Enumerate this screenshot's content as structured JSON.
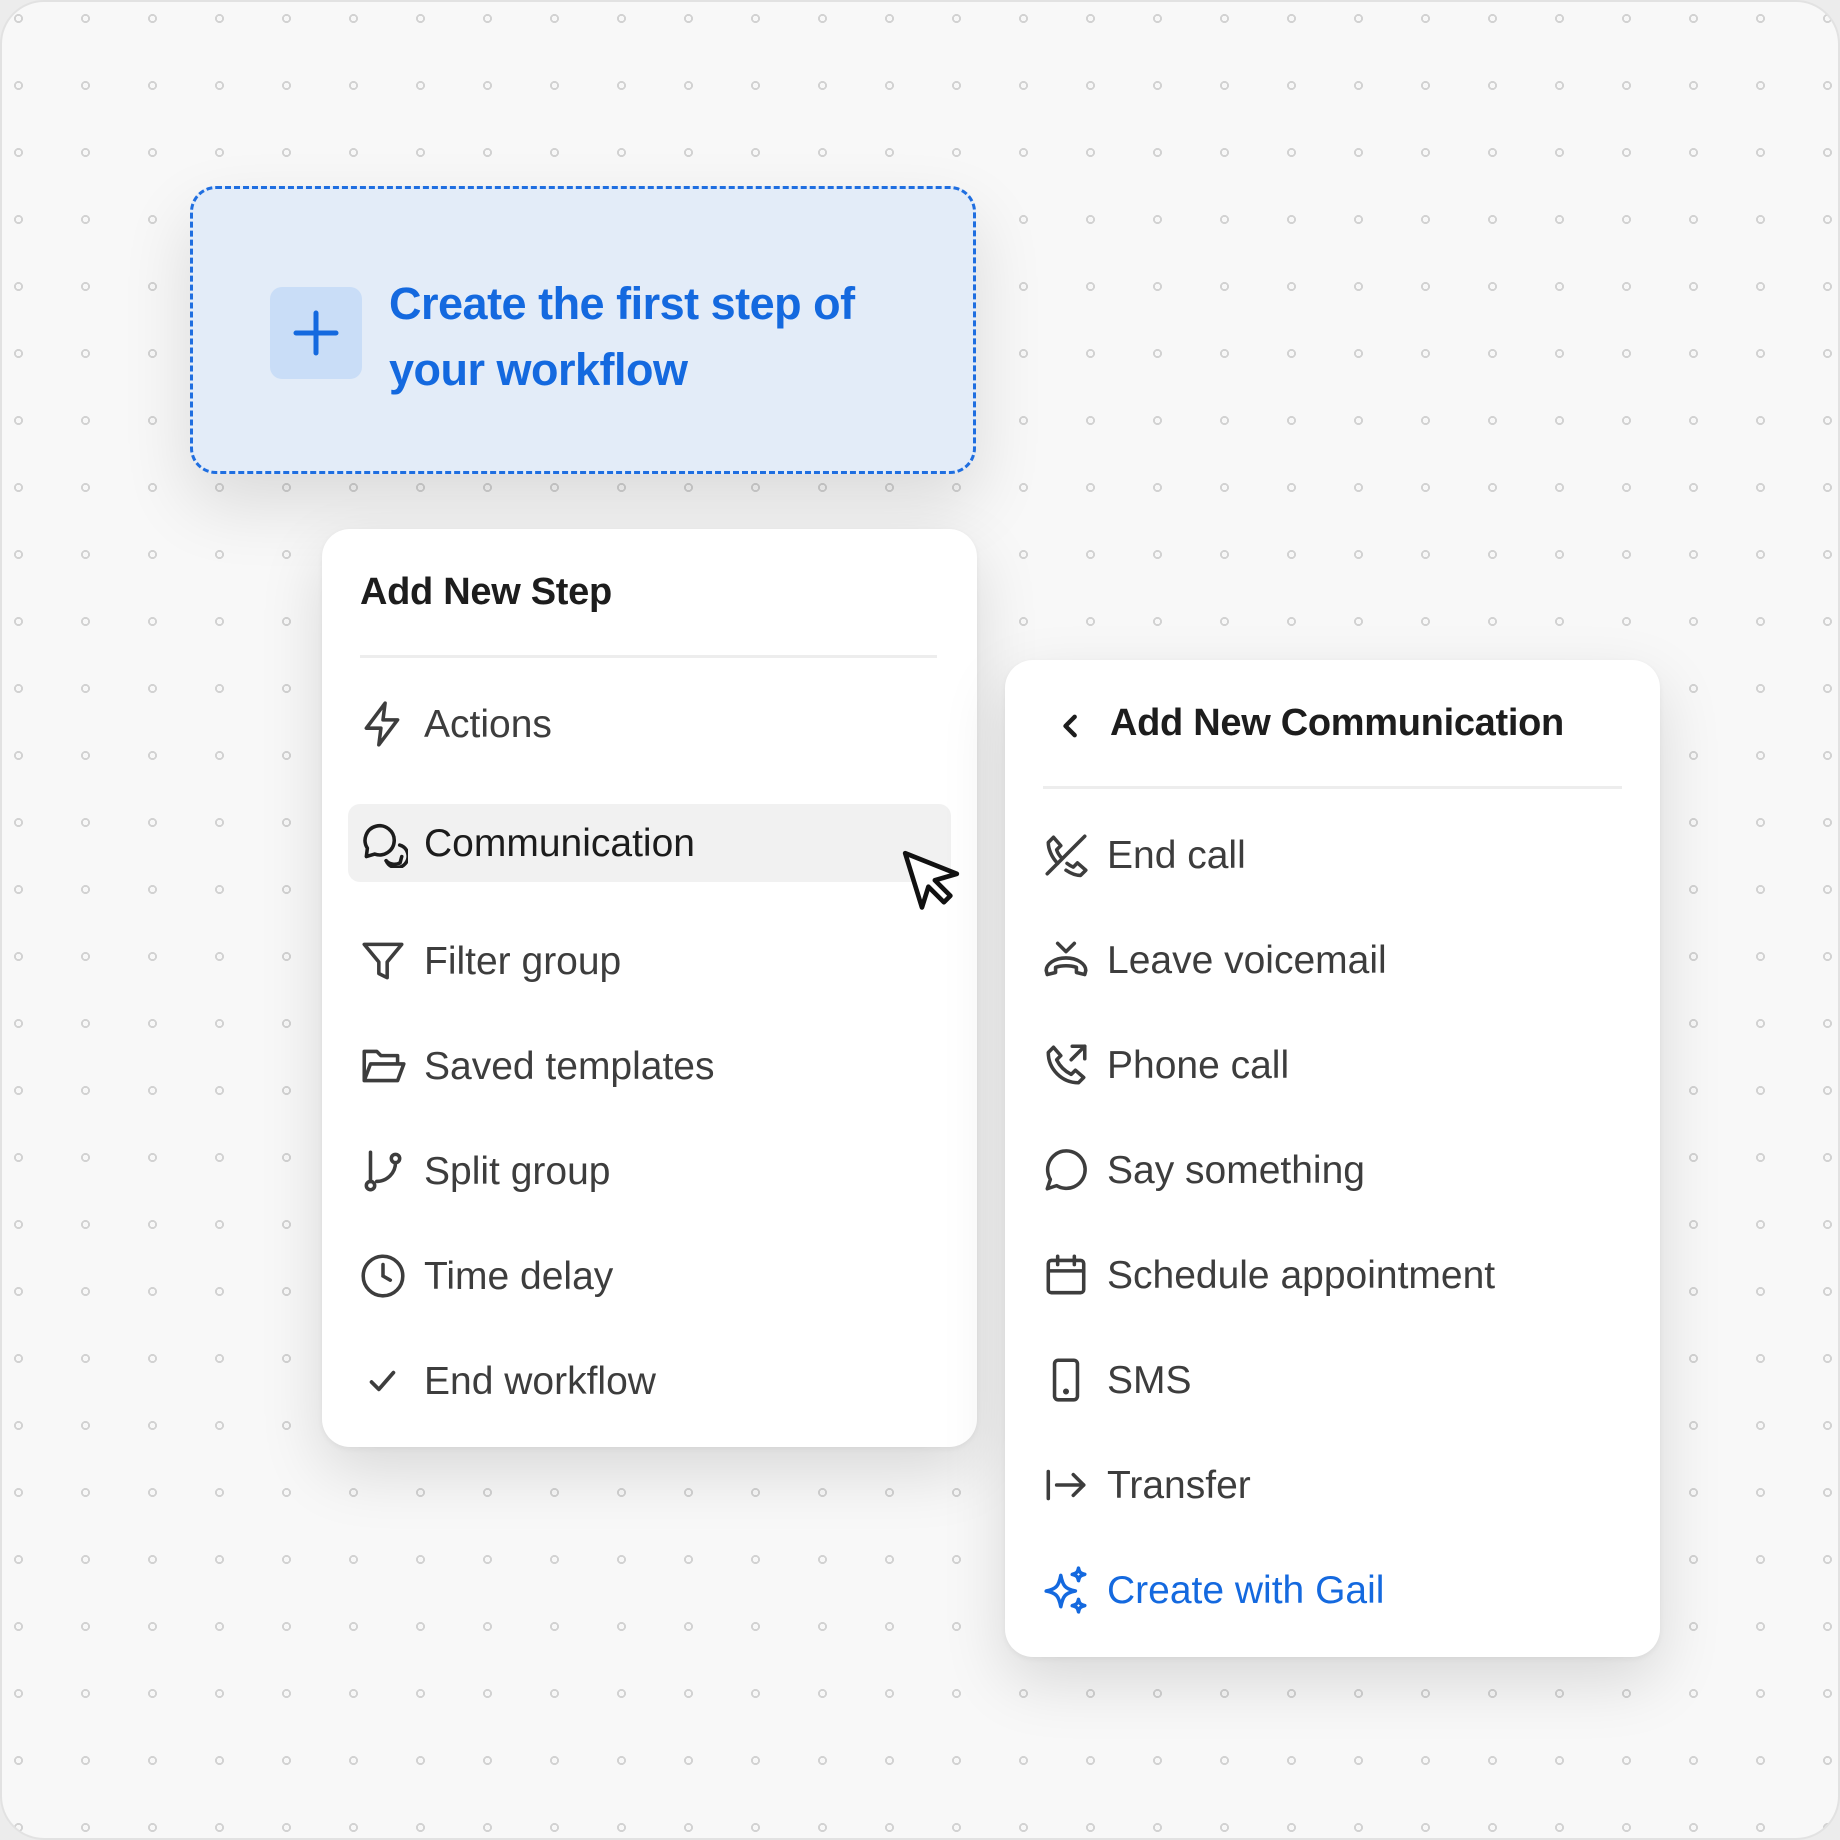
{
  "first_step": {
    "label": "Create the first step of your workflow",
    "icon": "plus-icon"
  },
  "add_step_menu": {
    "title": "Add New Step",
    "items": [
      {
        "label": "Actions",
        "icon": "lightning-icon"
      },
      {
        "label": "Communication",
        "icon": "chat-bubbles-icon",
        "selected": true
      },
      {
        "label": "Filter group",
        "icon": "filter-icon"
      },
      {
        "label": "Saved templates",
        "icon": "folder-icon"
      },
      {
        "label": "Split group",
        "icon": "git-branch-icon"
      },
      {
        "label": "Time delay",
        "icon": "clock-icon"
      },
      {
        "label": "End workflow",
        "icon": "check-icon"
      }
    ]
  },
  "communication_menu": {
    "title": "Add New Communication",
    "back_icon": "chevron-left-icon",
    "items": [
      {
        "label": "End call",
        "icon": "phone-off-icon"
      },
      {
        "label": "Leave voicemail",
        "icon": "phone-hangup-icon"
      },
      {
        "label": "Phone call",
        "icon": "phone-outgoing-icon"
      },
      {
        "label": "Say something",
        "icon": "message-circle-icon"
      },
      {
        "label": "Schedule appointment",
        "icon": "calendar-icon"
      },
      {
        "label": "SMS",
        "icon": "smartphone-icon"
      },
      {
        "label": "Transfer",
        "icon": "arrow-right-to-line-icon"
      },
      {
        "label": "Create with Gail",
        "icon": "sparkles-icon"
      }
    ]
  },
  "colors": {
    "accent": "#1469df",
    "first_step_bg": "#e3ecf8",
    "selected_item_bg": "#f1f1f1",
    "text": "#3d3d3d"
  }
}
